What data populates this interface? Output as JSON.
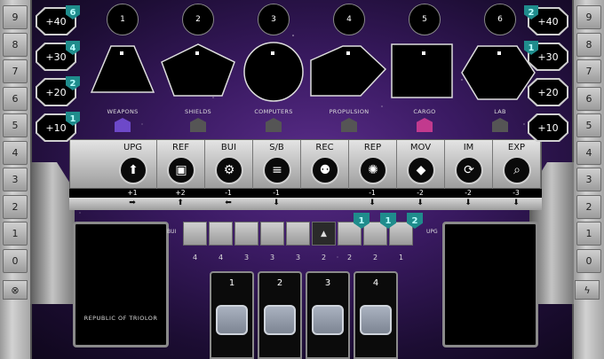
{
  "left_track": [
    "9",
    "8",
    "7",
    "6",
    "5",
    "4",
    "3",
    "2",
    "1",
    "0"
  ],
  "right_track": [
    "9",
    "8",
    "7",
    "6",
    "5",
    "4",
    "3",
    "2",
    "1",
    "0"
  ],
  "left_bonuses": [
    {
      "label": "+40",
      "chip": "6"
    },
    {
      "label": "+30",
      "chip": "4"
    },
    {
      "label": "+20",
      "chip": "2"
    },
    {
      "label": "+10",
      "chip": "1"
    }
  ],
  "right_bonuses": [
    {
      "label": "+40",
      "chip": "2"
    },
    {
      "label": "+30",
      "chip": "1"
    },
    {
      "label": "+20",
      "chip": ""
    },
    {
      "label": "+10",
      "chip": ""
    }
  ],
  "modules": [
    {
      "num": "1",
      "label": "WEAPONS",
      "icon": "chevron-up-icon"
    },
    {
      "num": "2",
      "label": "SHIELDS",
      "icon": "shield-icon"
    },
    {
      "num": "3",
      "label": "COMPUTERS",
      "icon": "chip-icon"
    },
    {
      "num": "4",
      "label": "PROPULSION",
      "icon": "engine-icon"
    },
    {
      "num": "5",
      "label": "CARGO",
      "icon": "cargo-icon"
    },
    {
      "num": "6",
      "label": "LAB",
      "icon": "lab-icon"
    }
  ],
  "actions": [
    {
      "label": "UPG",
      "cost": "+1",
      "arrow": "➡",
      "icon": "upgrade-icon"
    },
    {
      "label": "REF",
      "cost": "+2",
      "arrow": "⬆",
      "icon": "refine-icon"
    },
    {
      "label": "BUI",
      "cost": "-1",
      "arrow": "⬅",
      "icon": "build-icon"
    },
    {
      "label": "S/B",
      "cost": "-1",
      "arrow": "⬇",
      "icon": "sell-buy-icon"
    },
    {
      "label": "REC",
      "cost": "",
      "arrow": "",
      "icon": "recruit-icon"
    },
    {
      "label": "REP",
      "cost": "-1",
      "arrow": "⬇",
      "icon": "repair-icon"
    },
    {
      "label": "MOV",
      "cost": "-2",
      "arrow": "⬇",
      "icon": "move-icon"
    },
    {
      "label": "IM",
      "cost": "-2",
      "arrow": "⬇",
      "icon": "improve-icon"
    },
    {
      "label": "EXP",
      "cost": "-3",
      "arrow": "⬇",
      "icon": "explore-icon"
    }
  ],
  "ship_track": {
    "start_label": "BUI",
    "end_label": "UPG",
    "values": [
      "4",
      "4",
      "3",
      "3",
      "3",
      "2",
      "2",
      "2",
      "1"
    ],
    "chips": [
      "1",
      "1",
      "2"
    ]
  },
  "player_card": {
    "title": "REPUBLIC OF TRIOLOR"
  },
  "bottom_slots": [
    "1",
    "2",
    "3",
    "4"
  ],
  "colors": {
    "accent_teal": "#1f8c8c",
    "purple_bg": "#3a1a62"
  }
}
